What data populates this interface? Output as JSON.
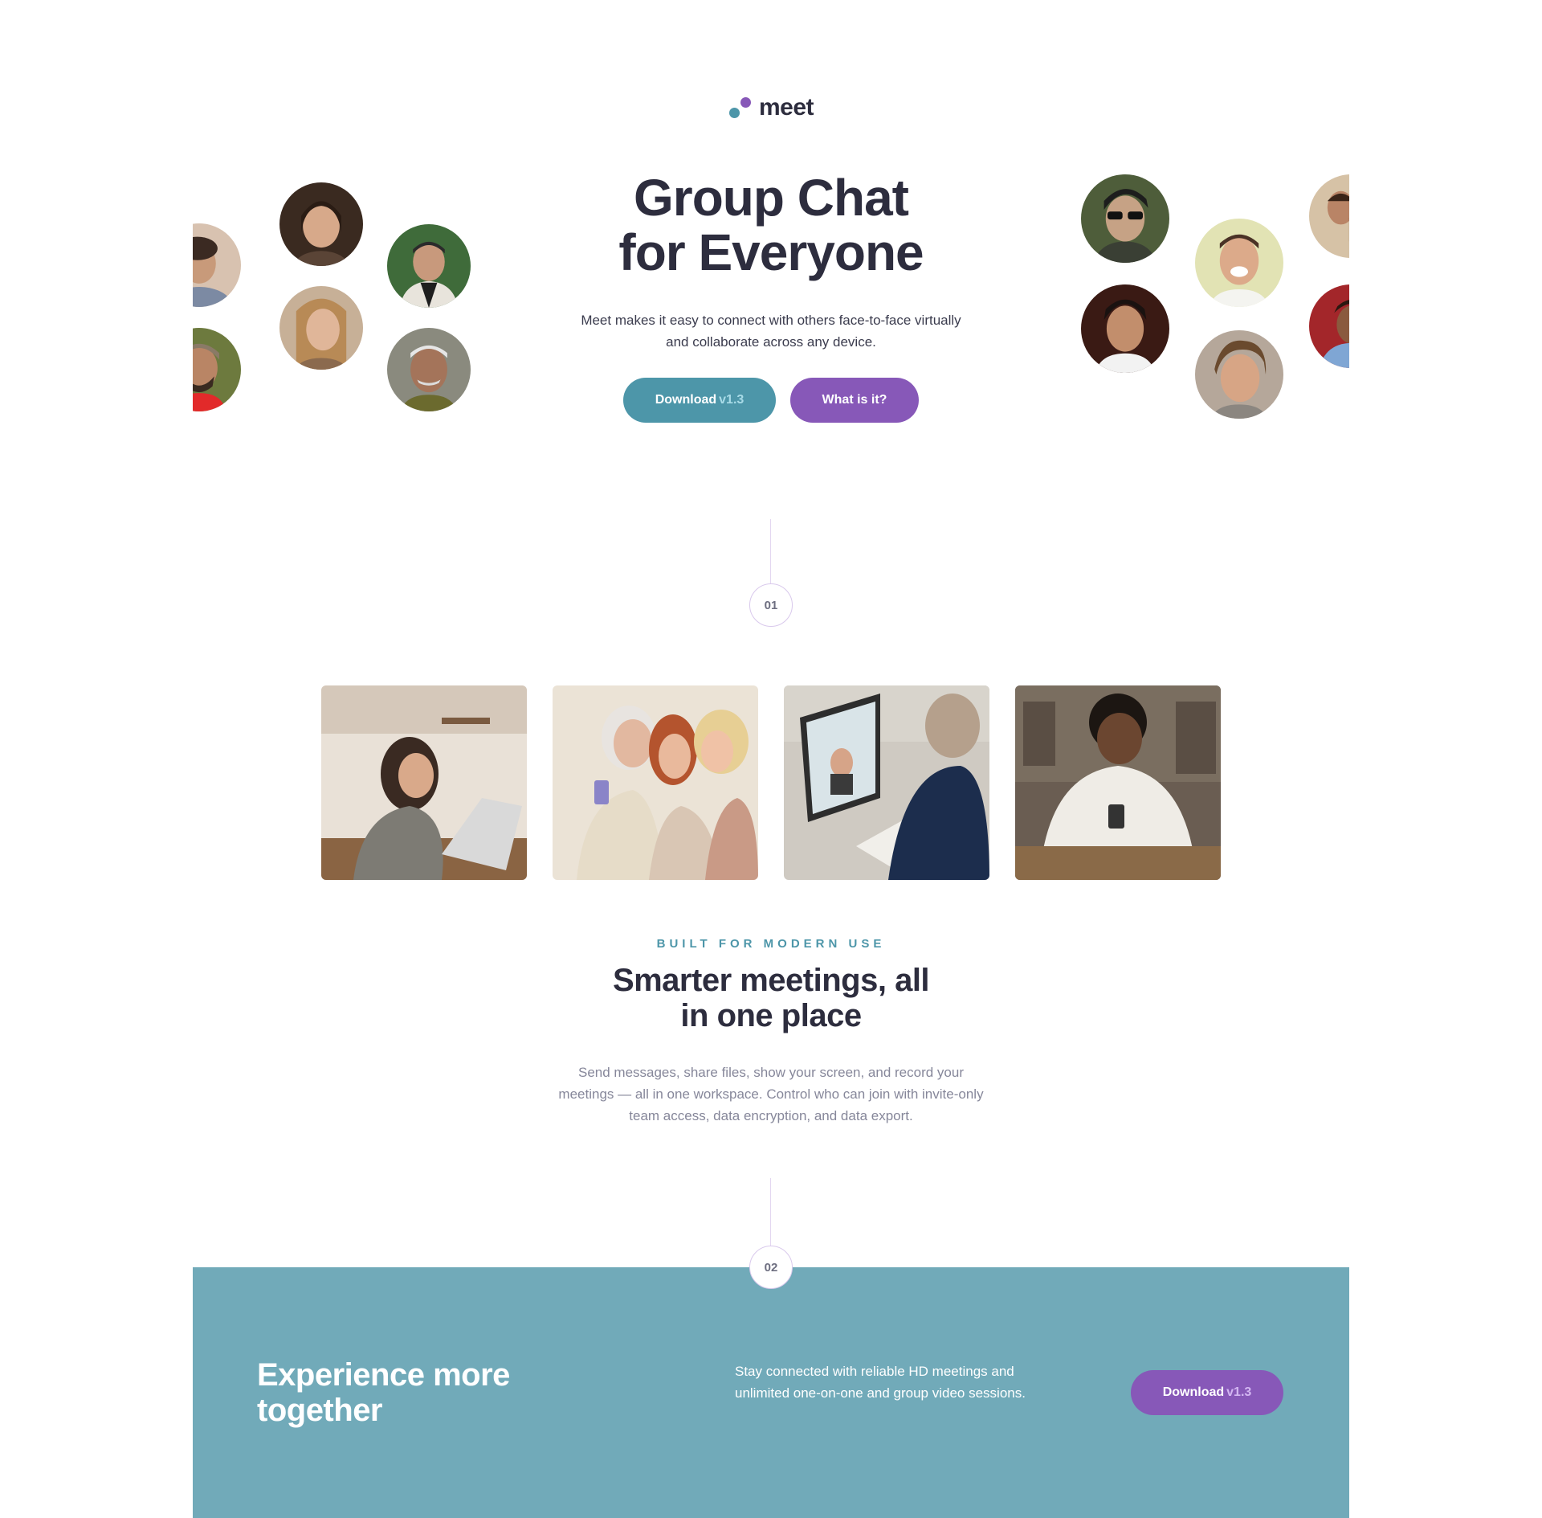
{
  "brand": {
    "name": "meet",
    "colors": {
      "teal": "#4d96a9",
      "purple": "#8758b8",
      "dark": "#2d2d3e",
      "band": "#71aab9"
    }
  },
  "hero": {
    "title_line1": "Group Chat",
    "title_line2": "for Everyone",
    "description": "Meet makes it easy to connect with others face-to-face virtually and collaborate across any device.",
    "download_label": "Download",
    "download_version": "v1.3",
    "what_label": "What is it?"
  },
  "steps": {
    "one": "01",
    "two": "02"
  },
  "features": {
    "eyebrow": "BUILT FOR MODERN USE",
    "title_line1": "Smarter meetings, all",
    "title_line2": "in one place",
    "description": "Send messages, share files, show your screen, and record your meetings — all in one workspace. Control who can join with invite-only team access, data encryption, and data export."
  },
  "cta": {
    "title_line1": "Experience more",
    "title_line2": "together",
    "description": "Stay connected with reliable HD meetings and unlimited one-on-one and group video sessions.",
    "download_label": "Download",
    "download_version": "v1.3"
  }
}
